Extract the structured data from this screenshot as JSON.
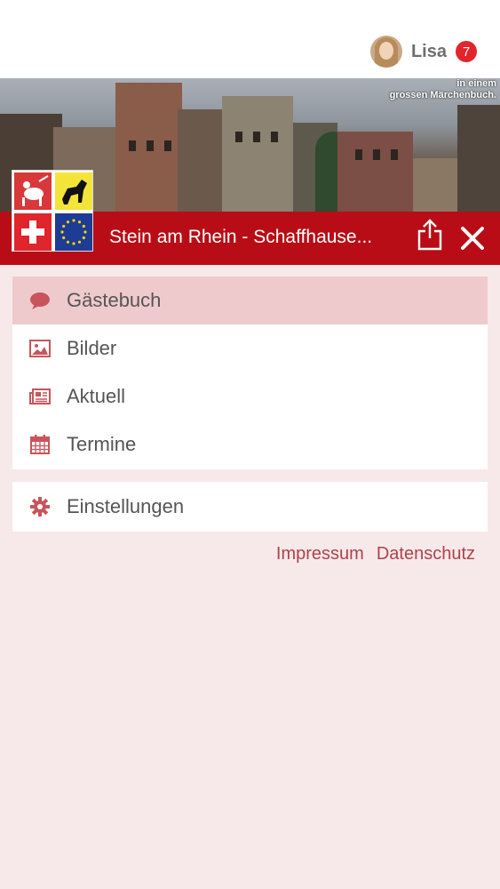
{
  "user": {
    "name": "Lisa",
    "notifications": "7"
  },
  "hero": {
    "caption_line1": "in einem",
    "caption_line2": "grossen Märchenbuch."
  },
  "header": {
    "title": "Stein am Rhein - Schaffhause..."
  },
  "menu": {
    "items": [
      {
        "label": "Gästebuch",
        "icon": "speech-bubble-icon",
        "active": true
      },
      {
        "label": "Bilder",
        "icon": "image-icon",
        "active": false
      },
      {
        "label": "Aktuell",
        "icon": "newspaper-icon",
        "active": false
      },
      {
        "label": "Termine",
        "icon": "calendar-icon",
        "active": false
      }
    ],
    "settings": {
      "label": "Einstellungen",
      "icon": "gear-icon"
    }
  },
  "footer": {
    "impressum": "Impressum",
    "datenschutz": "Datenschutz"
  },
  "colors": {
    "brand_red": "#b80d16",
    "icon_red": "#c9545c",
    "active_bg": "#efcacc",
    "page_bg": "#f7e9ea"
  }
}
